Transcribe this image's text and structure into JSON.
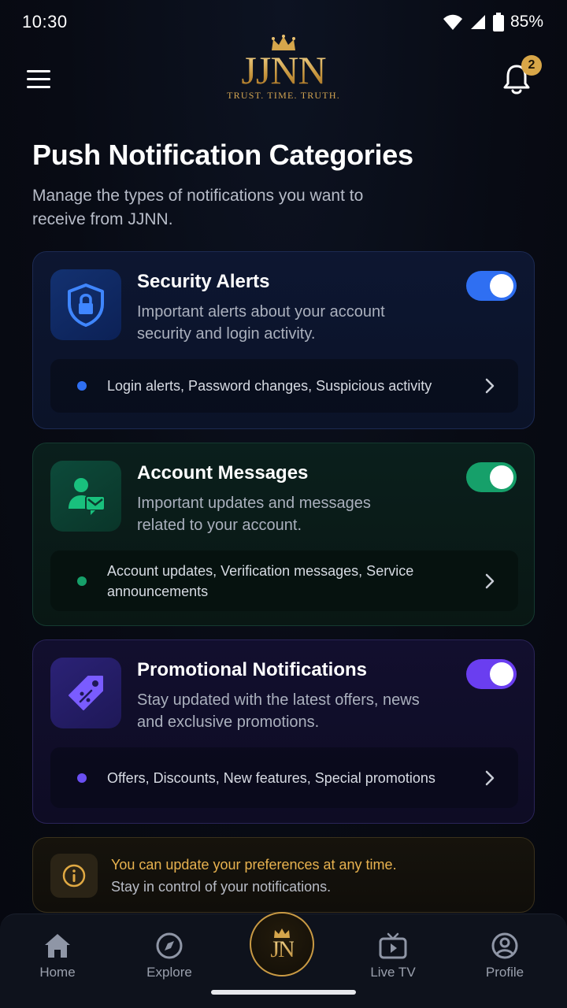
{
  "status_bar": {
    "time": "10:30",
    "battery": "85%"
  },
  "header": {
    "logo_text": "JJNN",
    "logo_tagline": "TRUST. TIME. TRUTH.",
    "notification_count": "2"
  },
  "page": {
    "title": "Push Notification Categories",
    "subtitle": "Manage the types of notifications you want to receive from JJNN."
  },
  "categories": [
    {
      "title": "Security Alerts",
      "description": "Important alerts about your account security and login activity.",
      "tags": "Login alerts, Password changes, Suspicious activity",
      "enabled": true,
      "accent": "#2f6ff2",
      "icon": "shield-lock-icon"
    },
    {
      "title": "Account Messages",
      "description": "Important updates and messages related to your account.",
      "tags": "Account updates, Verification messages, Service announcements",
      "enabled": true,
      "accent": "#16a06a",
      "icon": "user-message-icon"
    },
    {
      "title": "Promotional Notifications",
      "description": "Stay updated with the latest offers, news and exclusive promotions.",
      "tags": "Offers, Discounts, New features, Special promotions",
      "enabled": true,
      "accent": "#6a3ef0",
      "icon": "tag-icon"
    }
  ],
  "info": {
    "title": "You can update your preferences at any time.",
    "subtitle": "Stay in control of your notifications."
  },
  "bottom_nav": {
    "items": [
      {
        "label": "Home",
        "icon": "home-icon"
      },
      {
        "label": "Explore",
        "icon": "compass-icon"
      },
      {
        "label": "JN",
        "icon": "crown-logo-icon"
      },
      {
        "label": "Live TV",
        "icon": "tv-icon"
      },
      {
        "label": "Profile",
        "icon": "profile-icon"
      }
    ]
  }
}
